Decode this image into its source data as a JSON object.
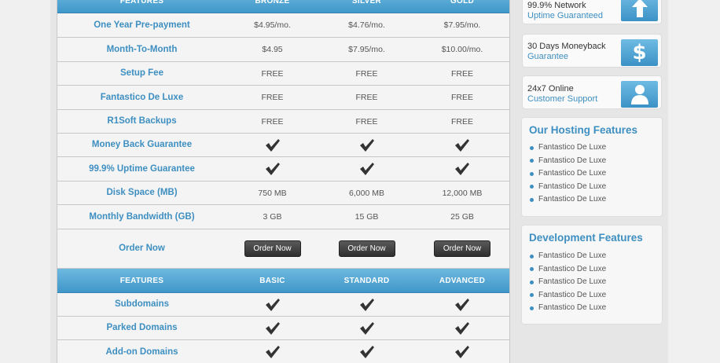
{
  "tables": [
    {
      "header": [
        "FEATURES",
        "BRONZE",
        "SILVER",
        "GOLD"
      ],
      "rows": [
        {
          "label": "One Year Pre-payment",
          "values": [
            "$4.95/mo.",
            "$4.76/mo.",
            "$7.95/mo."
          ]
        },
        {
          "label": "Month-To-Month",
          "values": [
            "$4.95",
            "$7.95/mo.",
            "$10.00/mo."
          ]
        },
        {
          "label": "Setup Fee",
          "values": [
            "FREE",
            "FREE",
            "FREE"
          ]
        },
        {
          "label": "Fantastico De Luxe",
          "values": [
            "FREE",
            "FREE",
            "FREE"
          ]
        },
        {
          "label": "R1Soft Backups",
          "values": [
            "FREE",
            "FREE",
            "FREE"
          ]
        },
        {
          "label": "Money Back Guarantee",
          "values": [
            "check",
            "check",
            "check"
          ]
        },
        {
          "label": "99.9% Uptime Guarantee",
          "values": [
            "check",
            "check",
            "check"
          ]
        },
        {
          "label": "Disk Space (MB)",
          "values": [
            "750 MB",
            "6,000 MB",
            "12,000 MB"
          ]
        },
        {
          "label": "Monthly Bandwidth (GB)",
          "values": [
            "3 GB",
            "15 GB",
            "25 GB"
          ]
        },
        {
          "label": "Order Now",
          "values": [
            "button",
            "button",
            "button"
          ]
        }
      ]
    },
    {
      "header": [
        "FEATURES",
        "BASIC",
        "STANDARD",
        "ADVANCED"
      ],
      "rows": [
        {
          "label": "Subdomains",
          "values": [
            "check",
            "check",
            "check"
          ]
        },
        {
          "label": "Parked Domains",
          "values": [
            "check",
            "check",
            "check"
          ]
        },
        {
          "label": "Add-on Domains",
          "values": [
            "check",
            "check",
            "check"
          ]
        }
      ]
    }
  ],
  "order_button_label": "Order Now",
  "promos": [
    {
      "line1": "99.9% Network",
      "line2": "Uptime Guaranteed",
      "icon": "arrow-up-icon"
    },
    {
      "line1": "30 Days Moneyback",
      "line2": "Guarantee",
      "icon": "dollar-icon"
    },
    {
      "line1": "24x7 Online",
      "line2": "Customer Support",
      "icon": "person-icon"
    }
  ],
  "panels": [
    {
      "title": "Our Hosting Features",
      "items": [
        "Fantastico De Luxe",
        "Fantastico De Luxe",
        "Fantastico De Luxe",
        "Fantastico De Luxe",
        "Fantastico De Luxe"
      ]
    },
    {
      "title": "Development Features",
      "items": [
        "Fantastico De Luxe",
        "Fantastico De Luxe",
        "Fantastico De Luxe",
        "Fantastico De Luxe",
        "Fantastico De Luxe"
      ]
    }
  ],
  "colors": {
    "accent": "#3e8fc1",
    "header_gradient_top": "#6fb9e0",
    "header_gradient_bottom": "#3f97c9",
    "button_dark": "#2e2e2e"
  }
}
